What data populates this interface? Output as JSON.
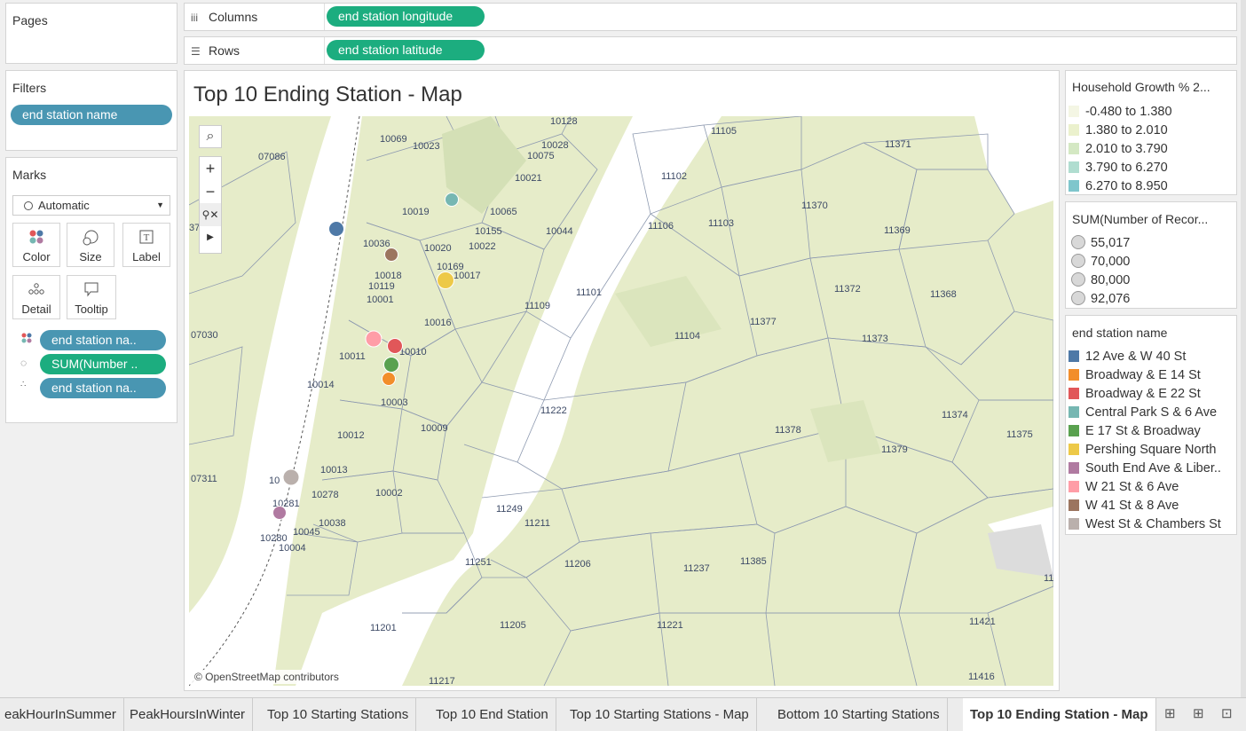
{
  "pages": {
    "title": "Pages"
  },
  "shelves": {
    "columns_label": "Columns",
    "columns_pill": "end station longitude",
    "rows_label": "Rows",
    "rows_pill": "end station latitude"
  },
  "filters": {
    "title": "Filters",
    "pill": "end station name"
  },
  "marks": {
    "title": "Marks",
    "type": "Automatic",
    "buttons": [
      "Color",
      "Size",
      "Label",
      "Detail",
      "Tooltip"
    ],
    "fields": [
      "end station na..",
      "SUM(Number ..",
      "end station na.."
    ]
  },
  "viz": {
    "title": "Top 10 Ending Station - Map",
    "attribution": "© OpenStreetMap contributors"
  },
  "legend_household": {
    "title": "Household Growth % 2...",
    "items": [
      "-0.480 to 1.380",
      "1.380 to 2.010",
      "2.010 to 3.790",
      "3.790 to 6.270",
      "6.270 to 8.950"
    ],
    "colors": [
      "#f4f6e4",
      "#ebf1cd",
      "#d4e8c3",
      "#b0ddd0",
      "#7fc6cc"
    ]
  },
  "legend_size": {
    "title": "SUM(Number of Recor...",
    "items": [
      "55,017",
      "70,000",
      "80,000",
      "92,076"
    ]
  },
  "legend_station": {
    "title": "end station name",
    "items": [
      {
        "name": "12 Ave & W 40 St",
        "color": "#4e79a7"
      },
      {
        "name": "Broadway & E 14 St",
        "color": "#f28e2b"
      },
      {
        "name": "Broadway & E 22 St",
        "color": "#e15759"
      },
      {
        "name": "Central Park S & 6 Ave",
        "color": "#76b7b2"
      },
      {
        "name": "E 17 St & Broadway",
        "color": "#59a14f"
      },
      {
        "name": "Pershing Square North",
        "color": "#edc948"
      },
      {
        "name": "South End Ave & Liber..",
        "color": "#b07aa1"
      },
      {
        "name": "W 21 St & 6 Ave",
        "color": "#ff9da7"
      },
      {
        "name": "W 41 St & 8 Ave",
        "color": "#9c755f"
      },
      {
        "name": "West St & Chambers St",
        "color": "#bab0ac"
      }
    ]
  },
  "tabs": [
    "eakHourInSummer",
    "PeakHoursInWinter",
    "Top 10 Starting Stations",
    "Top 10 End Station",
    "Top 10 Starting Stations - Map",
    "Bottom 10 Starting Stations",
    "Top 10 Ending Station - Map"
  ],
  "zip_labels": [
    "10128",
    "10069",
    "10023",
    "10028",
    "10075",
    "07086",
    "10021",
    "10019",
    "10065",
    "10155",
    "10022",
    "10044",
    "10036",
    "10020",
    "10018",
    "10169",
    "10017",
    "10119",
    "10001",
    "10016",
    "10010",
    "10011",
    "10014",
    "10003",
    "10009",
    "10012",
    "10013",
    "10278",
    "10002",
    "10281",
    "10280",
    "10045",
    "10038",
    "10004",
    "10",
    "07030",
    "07311",
    "11105",
    "11371",
    "11102",
    "11370",
    "11106",
    "11103",
    "11369",
    "11101",
    "11109",
    "11372",
    "11368",
    "11377",
    "11104",
    "11373",
    "11222",
    "11378",
    "11374",
    "11375",
    "11379",
    "11249",
    "11211",
    "11206",
    "11251",
    "11237",
    "11385",
    "11205",
    "11201",
    "11221",
    "11421",
    "11217",
    "11416",
    "11",
    "37"
  ]
}
